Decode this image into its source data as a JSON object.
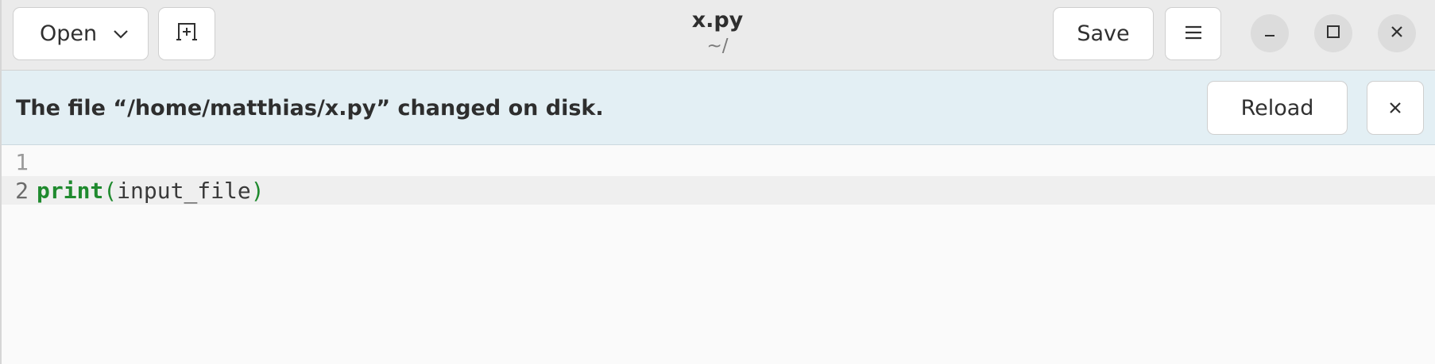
{
  "header": {
    "open_label": "Open",
    "save_label": "Save",
    "title": "x.py",
    "subtitle": "~/"
  },
  "infobar": {
    "message": "The file “/home/matthias/x.py” changed on disk.",
    "reload_label": "Reload"
  },
  "editor": {
    "lines": [
      {
        "number": "1"
      },
      {
        "number": "2",
        "keyword": "print",
        "open_paren": "(",
        "argument": "input_file",
        "close_paren": ")"
      }
    ]
  },
  "icons": {
    "open_dropdown": "chevron-down-icon",
    "new_tab": "new-tab-icon",
    "menu": "hamburger-menu-icon",
    "minimize": "minimize-icon",
    "maximize": "maximize-icon",
    "close": "close-icon",
    "dismiss": "close-icon"
  },
  "colors": {
    "header_bg": "#ebebeb",
    "infobar_bg": "#e3eff4",
    "keyword": "#1f8a2e",
    "current_line_bg": "#efefef"
  }
}
